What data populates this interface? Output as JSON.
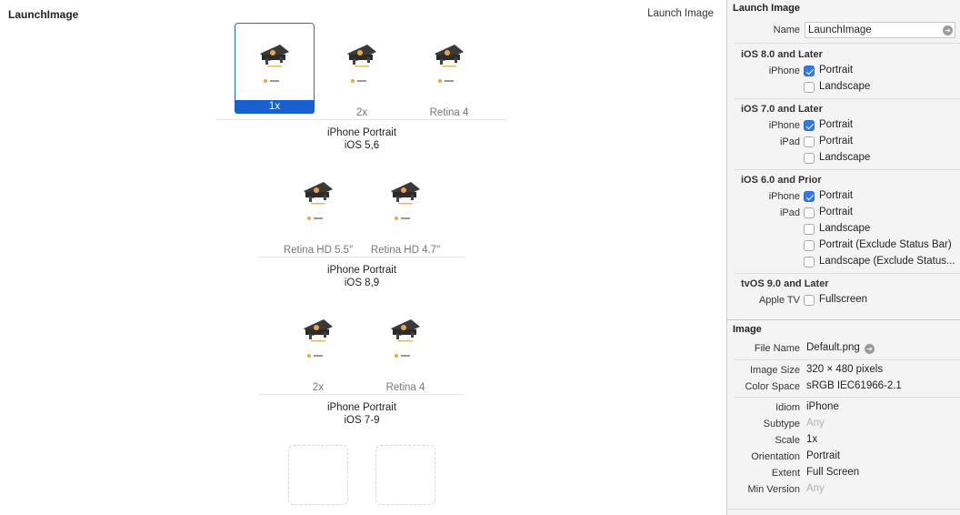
{
  "canvas": {
    "set_title": "LaunchImage",
    "set_name_right": "Launch Image",
    "groups": [
      {
        "line1": "iPhone Portrait",
        "line2": "iOS 5,6",
        "slots": [
          "1x",
          "2x",
          "Retina 4"
        ]
      },
      {
        "line1": "iPhone Portrait",
        "line2": "iOS 8,9",
        "slots": [
          "Retina HD 5.5″",
          "Retina HD 4.7″"
        ]
      },
      {
        "line1": "iPhone Portrait",
        "line2": "iOS 7-9",
        "slots": [
          "2x",
          "Retina 4"
        ]
      }
    ]
  },
  "inspector": {
    "launch_image_title": "Launch Image",
    "name_label": "Name",
    "name_value": "LaunchImage",
    "ios8_title": "iOS 8.0 and Later",
    "ios8_iphone_label": "iPhone",
    "ios8_portrait": "Portrait",
    "ios8_landscape": "Landscape",
    "ios7_title": "iOS 7.0 and Later",
    "ios7_iphone_label": "iPhone",
    "ios7_iphone_portrait": "Portrait",
    "ios7_ipad_label": "iPad",
    "ios7_ipad_portrait": "Portrait",
    "ios7_ipad_landscape": "Landscape",
    "ios6_title": "iOS 6.0 and Prior",
    "ios6_iphone_label": "iPhone",
    "ios6_iphone_portrait": "Portrait",
    "ios6_ipad_label": "iPad",
    "ios6_ipad_portrait": "Portrait",
    "ios6_ipad_landscape": "Landscape",
    "ios6_ipad_portrait_excl": "Portrait (Exclude Status Bar)",
    "ios6_ipad_landscape_excl": "Landscape (Exclude Status...",
    "tvos_title": "tvOS 9.0 and Later",
    "tvos_appletv_label": "Apple TV",
    "tvos_fullscreen": "Fullscreen",
    "image_title": "Image",
    "file_name_label": "File Name",
    "file_name_value": "Default.png",
    "image_size_label": "Image Size",
    "image_size_value": "320 × 480 pixels",
    "color_space_label": "Color Space",
    "color_space_value": "sRGB IEC61966-2.1",
    "idiom_label": "Idiom",
    "idiom_value": "iPhone",
    "subtype_label": "Subtype",
    "subtype_value": "Any",
    "scale_label": "Scale",
    "scale_value": "1x",
    "orientation_label": "Orientation",
    "orientation_value": "Portrait",
    "extent_label": "Extent",
    "extent_value": "Full Screen",
    "min_version_label": "Min Version",
    "min_version_value": "Any"
  },
  "checks": {
    "ios8_portrait": true,
    "ios8_landscape": false,
    "ios7_iphone_portrait": true,
    "ios7_ipad_portrait": false,
    "ios7_ipad_landscape": false,
    "ios6_iphone_portrait": true,
    "ios6_ipad_portrait": false,
    "ios6_ipad_landscape": false,
    "ios6_ipad_portrait_excl": false,
    "ios6_ipad_landscape_excl": false,
    "tvos_fullscreen": false
  },
  "colors": {
    "accent": "#1660cf",
    "check_on": "#2f7ae5"
  }
}
